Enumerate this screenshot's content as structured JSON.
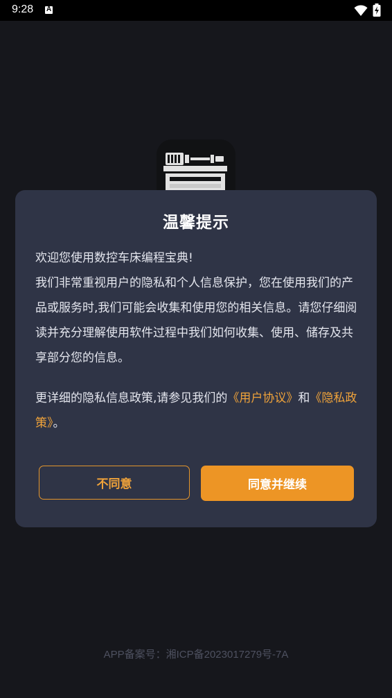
{
  "status_bar": {
    "time": "9:28",
    "icons": [
      "a-notification-icon",
      "wifi-icon",
      "battery-charging-icon"
    ]
  },
  "app": {
    "icon": "cnc-lathe-icon"
  },
  "dialog": {
    "title": "温馨提示",
    "welcome": "欢迎您使用数控车床编程宝典!",
    "paragraph": "我们非常重视用户的隐私和个人信息保护，您在使用我们的产品或服务时,我们可能会收集和使用您的相关信息。请您仔细阅读并充分理解使用软件过程中我们如何收集、使用、储存及共享部分您的信息。",
    "policy_prefix": "更详细的隐私信息政策,请参见我们的",
    "user_agreement_link": "《用户协议》",
    "policy_and": "和",
    "privacy_policy_link": "《隐私政策》",
    "policy_suffix": "。",
    "disagree_label": "不同意",
    "agree_label": "同意并继续"
  },
  "footer": {
    "record_text": "APP备案号：湘ICP备2023017279号-7A"
  },
  "colors": {
    "background": "#16171c",
    "dialog_background": "#2f3446",
    "accent": "#ed9525",
    "link": "#f0a33a"
  }
}
